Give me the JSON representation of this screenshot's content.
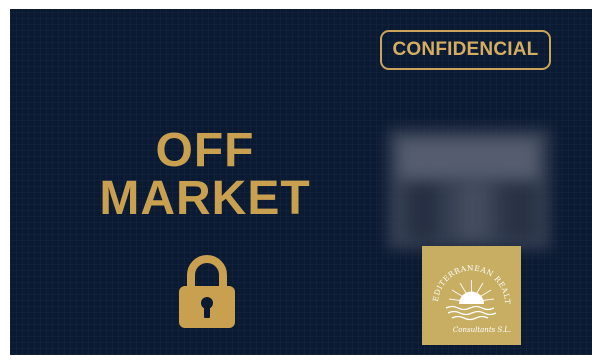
{
  "badge": {
    "label": "CONFIDENCIAL"
  },
  "headline": {
    "line1": "OFF",
    "line2": "MARKET"
  },
  "icons": {
    "lock": "lock-icon"
  },
  "logo": {
    "arc_text": "MEDITERRANEAN REALTY",
    "script_text": "Consultants S.L."
  },
  "colors": {
    "background": "#0b1a33",
    "accent_gold": "#c9a04f",
    "logo_gold": "#c7ae62"
  }
}
